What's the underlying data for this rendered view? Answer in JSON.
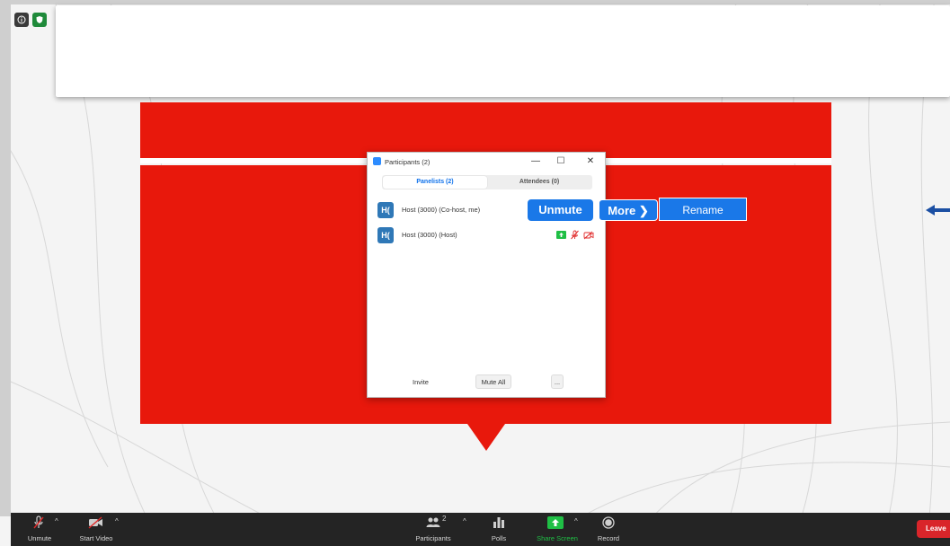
{
  "meeting": {
    "info_icon": "info-icon",
    "security_icon": "shield-icon"
  },
  "participants_panel": {
    "title": "Participants (2)",
    "tabs": [
      {
        "label": "Panelists (2)"
      },
      {
        "label": "Attendees (0)"
      }
    ],
    "rows": [
      {
        "avatar": "H(",
        "name": "Host (3000) (Co-host, me)"
      },
      {
        "avatar": "H(",
        "name": "Host (3000) (Host)"
      }
    ],
    "footer": {
      "invite": "Invite",
      "mute_all": "Mute All",
      "more": "..."
    }
  },
  "actions": {
    "unmute": "Unmute",
    "more": "More ❯",
    "rename": "Rename"
  },
  "toolbar": {
    "unmute": "Unmute",
    "start_video": "Start Video",
    "participants": "Participants",
    "participants_count": "2",
    "polls": "Polls",
    "share_screen": "Share Screen",
    "record": "Record",
    "leave": "Leave"
  },
  "colors": {
    "brand_red": "#e8180c",
    "zoom_blue": "#1a78e8",
    "share_green": "#1fbf45",
    "leave_red": "#d9252a"
  }
}
